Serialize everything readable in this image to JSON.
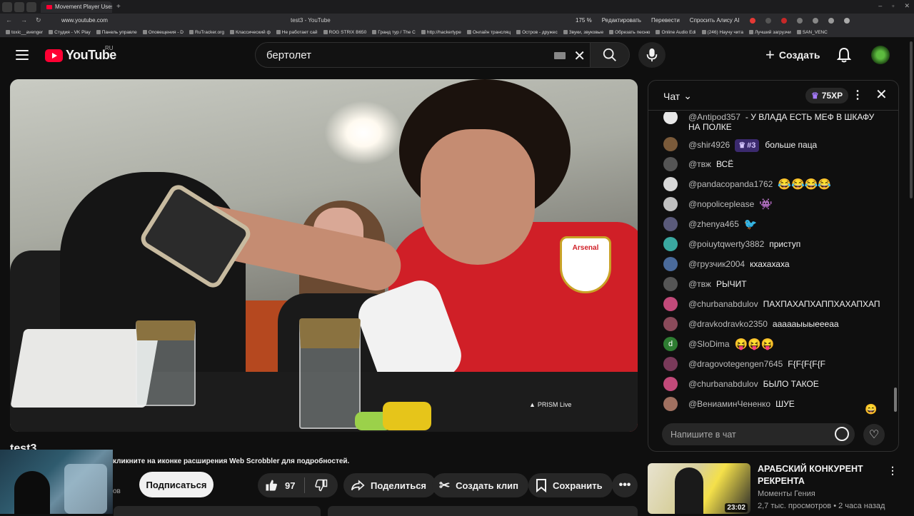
{
  "browser": {
    "tab_title": "Movement Player Uses N",
    "url": "www.youtube.com",
    "page_title": "test3 - YouTube",
    "zoom": "175 %",
    "edit_label": "Редактировать",
    "translate_label": "Перевести",
    "alice_label": "Спросить Алису AI",
    "bookmarks": [
      "toxic__avenger",
      "Студия - VK Play",
      "Панель управле",
      "Оповещения - D",
      "RuTracker.org",
      "Классический ф",
      "Не работает сай",
      "ROG STRIX B650",
      "Гранд тур / The C",
      "http://hackertype",
      "Онлайн трансляц",
      "Остров - дружес",
      "Звуки, звуковые",
      "Обрезать песню",
      "Online Audio Edi",
      "(246) Научу чита",
      "Лучший загрузчи",
      "SAN_VENC"
    ]
  },
  "header": {
    "logo_text": "YouTube",
    "region": "RU",
    "search_value": "бертолет",
    "create_label": "Создать"
  },
  "video": {
    "title": "test3",
    "overlay_label": "PRISM Live",
    "overlay_bold": "PRISM",
    "badge_text": "Arsenal",
    "scrobbler_notice": "кликните на иконке расширения Web Scrobbler для подробностей.",
    "channel_sub": "ов",
    "subscribe_label": "Подписаться",
    "likes": "97",
    "share_label": "Поделиться",
    "clip_label": "Создать клип",
    "save_label": "Сохранить"
  },
  "chat": {
    "title": "Чат",
    "xp": "75XP",
    "input_placeholder": "Напишите в чат",
    "messages": [
      {
        "author": "@Antipod357",
        "text": "- У ВЛАДА ЕСТЬ МЕФ В ШКАФУ НА ПОЛКЕ",
        "avatar_color": "#e8e8e8"
      },
      {
        "author": "@shir4926",
        "rank": "#3",
        "text": "больше паца",
        "avatar_color": "#7a5a3a"
      },
      {
        "author": "@твж",
        "text": "ВСЁ",
        "avatar_color": "#555555"
      },
      {
        "author": "@pandacopanda1762",
        "text": "😂😂😂😂",
        "avatar_color": "#d8d8d8"
      },
      {
        "author": "@nopoliceplease",
        "text": "👾",
        "avatar_color": "#c0c0c0"
      },
      {
        "author": "@zhenya465",
        "text": "🐦",
        "avatar_color": "#5a5a7a"
      },
      {
        "author": "@poiuytqwerty3882",
        "text": "приступ",
        "avatar_color": "#3aa8a0"
      },
      {
        "author": "@грузчик2004",
        "text": "кхахахаха",
        "avatar_color": "#4a6a9a"
      },
      {
        "author": "@твж",
        "text": "РЫЧИТ",
        "avatar_color": "#555555"
      },
      {
        "author": "@churbanabdulov",
        "text": "ПАХПАХАПХАППХАХАПХАП",
        "avatar_color": "#c24a7a"
      },
      {
        "author": "@dravkodravko2350",
        "text": "аааааыыыеееаа",
        "avatar_color": "#8a4a5a"
      },
      {
        "author": "@SloDima",
        "text": "😝😝😝",
        "avatar_color": "#2e7d32",
        "avatar_letter": "d"
      },
      {
        "author": "@dragovotegengen7645",
        "text": "F{F{F{F{F",
        "avatar_color": "#7a3a5a"
      },
      {
        "author": "@churbanabdulov",
        "text": "БЫЛО ТАКОЕ",
        "avatar_color": "#c24a7a"
      },
      {
        "author": "@ВениаминЧененко",
        "text": "ШУЕ",
        "avatar_color": "#a07060"
      }
    ]
  },
  "recommended": {
    "title": "АРАБСКИЙ КОНКУРЕНТ РЕКРЕНТА",
    "channel": "Моменты Гения",
    "meta": "2,7 тыс. просмотров • 2 часа назад",
    "duration": "23:02"
  }
}
